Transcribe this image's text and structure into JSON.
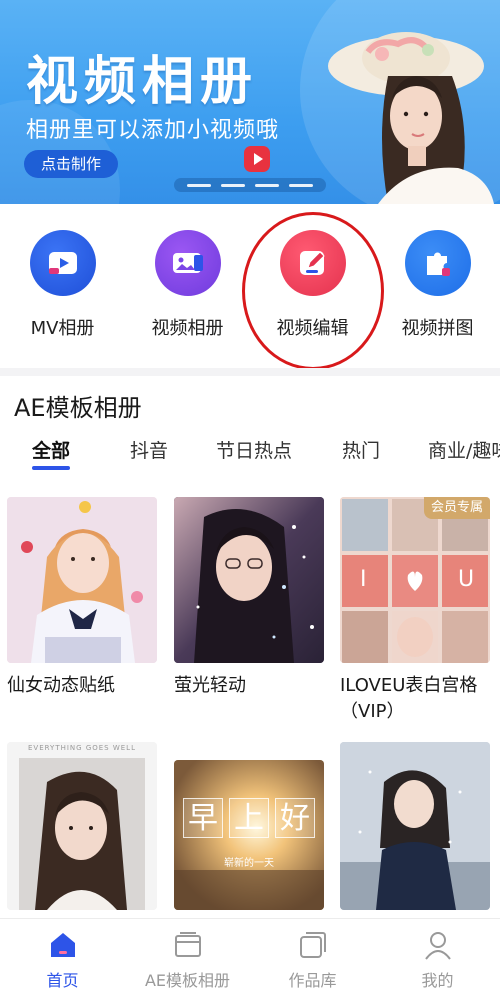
{
  "banner": {
    "title": "视频相册",
    "subtitle": "相册里可以添加小视频哦",
    "button_label": "点击制作"
  },
  "features": [
    {
      "label": "MV相册",
      "icon": "mv-album-icon"
    },
    {
      "label": "视频相册",
      "icon": "video-album-icon"
    },
    {
      "label": "视频编辑",
      "icon": "video-edit-icon"
    },
    {
      "label": "视频拼图",
      "icon": "puzzle-icon"
    }
  ],
  "section": {
    "title": "AE模板相册",
    "tabs": [
      "全部",
      "抖音",
      "节日热点",
      "热门",
      "商业/趣味"
    ]
  },
  "cards": [
    {
      "title": "仙女动态贴纸"
    },
    {
      "title": "萤光轻动"
    },
    {
      "title": "ILOVEU表白宫格（VIP）",
      "badge": "会员专属"
    },
    {
      "title": ""
    },
    {
      "title": ""
    },
    {
      "title": ""
    }
  ],
  "thumb_text": {
    "card5_chars": [
      "早",
      "上",
      "好"
    ],
    "card5_caption": "崭新的一天",
    "card3_letters": [
      "I",
      "U"
    ],
    "card4_caption": "EVERYTHING GOES WELL"
  },
  "bottom_nav": [
    {
      "label": "首页",
      "icon": "home-icon",
      "active": true
    },
    {
      "label": "AE模板相册",
      "icon": "template-icon",
      "active": false
    },
    {
      "label": "作品库",
      "icon": "library-icon",
      "active": false
    },
    {
      "label": "我的",
      "icon": "profile-icon",
      "active": false
    }
  ],
  "colors": {
    "accent": "#2d54e8",
    "banner_bg": "#4aa8f2",
    "highlight_ring": "#d8191b",
    "vip_badge": "#d2a86a"
  }
}
